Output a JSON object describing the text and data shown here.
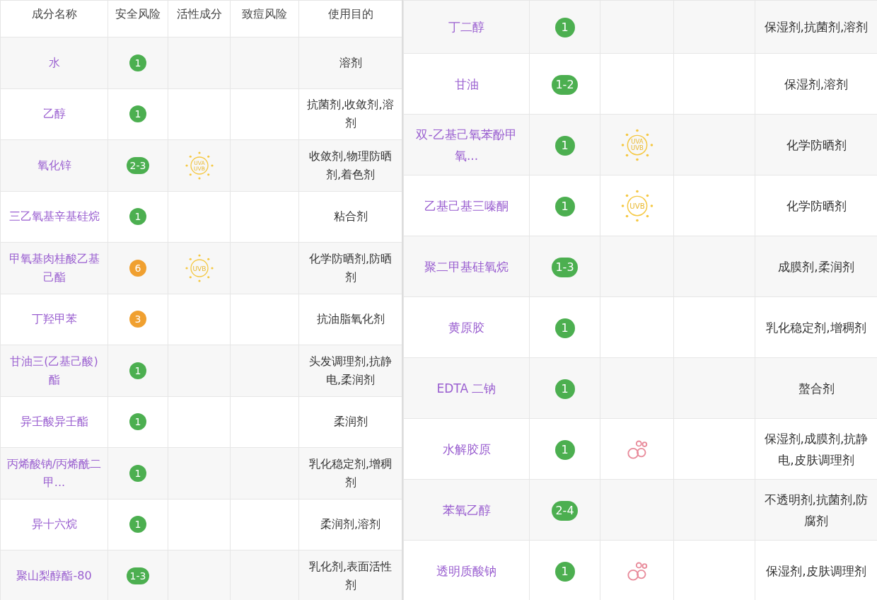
{
  "left_table": {
    "columns": [
      "成分名称",
      "安全风险",
      "活性成分",
      "致痘风险",
      "使用目的"
    ],
    "rows": [
      {
        "name": "水",
        "risk": "1",
        "color": "#4caf50",
        "purpose": "溶剂"
      },
      {
        "name": "乙醇",
        "risk": "1",
        "color": "#4caf50",
        "purpose": "抗菌剂,收敛剂,溶剂"
      },
      {
        "name": "氧化锌",
        "risk": "2-3",
        "color": "#4caf50",
        "active": {
          "kind": "sun",
          "text": [
            "UVA",
            "UVB"
          ]
        },
        "purpose": "收敛剂,物理防晒剂,着色剂"
      },
      {
        "name": "三乙氧基辛基硅烷",
        "risk": "1",
        "color": "#4caf50",
        "purpose": "粘合剂"
      },
      {
        "name": "甲氧基肉桂酸乙基己酯",
        "risk": "6",
        "color": "#f0a030",
        "active": {
          "kind": "sun",
          "text": [
            "UVB"
          ]
        },
        "purpose": "化学防晒剂,防晒剂"
      },
      {
        "name": "丁羟甲苯",
        "risk": "3",
        "color": "#f0a030",
        "purpose": "抗油脂氧化剂"
      },
      {
        "name": "甘油三(乙基己酸)酯",
        "risk": "1",
        "color": "#4caf50",
        "purpose": "头发调理剂,抗静电,柔润剂"
      },
      {
        "name": "异壬酸异壬酯",
        "risk": "1",
        "color": "#4caf50",
        "purpose": "柔润剂"
      },
      {
        "name": "丙烯酸钠/丙烯酰二甲...",
        "risk": "1",
        "color": "#4caf50",
        "purpose": "乳化稳定剂,增稠剂"
      },
      {
        "name": "异十六烷",
        "risk": "1",
        "color": "#4caf50",
        "purpose": "柔润剂,溶剂"
      },
      {
        "name": "聚山梨醇酯-80",
        "risk": "1-3",
        "color": "#4caf50",
        "purpose": "乳化剂,表面活性剂"
      }
    ]
  },
  "right_table": {
    "rows": [
      {
        "name": "丁二醇",
        "risk": "1",
        "color": "#4caf50",
        "purpose": "保湿剂,抗菌剂,溶剂"
      },
      {
        "name": "甘油",
        "risk": "1-2",
        "color": "#4caf50",
        "purpose": "保湿剂,溶剂"
      },
      {
        "name": "双-乙基己氧苯酚甲氧...",
        "risk": "1",
        "color": "#4caf50",
        "active": {
          "kind": "sun",
          "text": [
            "UVA",
            "UVB"
          ]
        },
        "purpose": "化学防晒剂"
      },
      {
        "name": "乙基己基三嗪酮",
        "risk": "1",
        "color": "#4caf50",
        "active": {
          "kind": "sun",
          "text": [
            "UVB"
          ]
        },
        "purpose": "化学防晒剂"
      },
      {
        "name": "聚二甲基硅氧烷",
        "risk": "1-3",
        "color": "#4caf50",
        "purpose": "成膜剂,柔润剂"
      },
      {
        "name": "黄原胶",
        "risk": "1",
        "color": "#4caf50",
        "purpose": "乳化稳定剂,增稠剂"
      },
      {
        "name": "EDTA 二钠",
        "risk": "1",
        "color": "#4caf50",
        "purpose": "螯合剂"
      },
      {
        "name": "水解胶原",
        "risk": "1",
        "color": "#4caf50",
        "active": {
          "kind": "bubbles"
        },
        "purpose": "保湿剂,成膜剂,抗静电,皮肤调理剂"
      },
      {
        "name": "苯氧乙醇",
        "risk": "2-4",
        "color": "#4caf50",
        "purpose": "不透明剂,抗菌剂,防腐剂"
      },
      {
        "name": "透明质酸钠",
        "risk": "1",
        "color": "#4caf50",
        "active": {
          "kind": "bubbles"
        },
        "purpose": "保湿剂,皮肤调理剂"
      }
    ]
  }
}
